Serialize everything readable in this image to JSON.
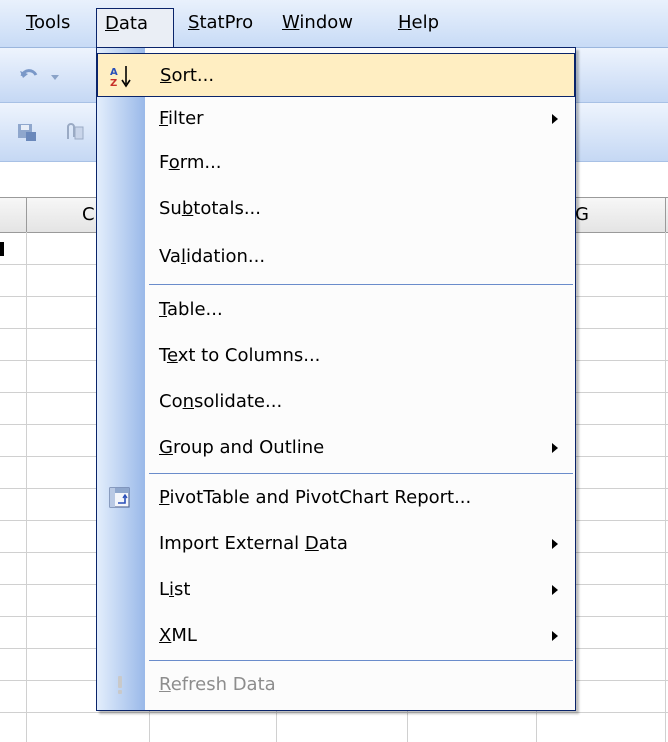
{
  "menubar": {
    "items": [
      {
        "prefix": "",
        "mnemonic": "T",
        "suffix": "ools"
      },
      {
        "prefix": "",
        "mnemonic": "D",
        "suffix": "ata"
      },
      {
        "prefix": "",
        "mnemonic": "S",
        "suffix": "tatPro"
      },
      {
        "prefix": "",
        "mnemonic": "W",
        "suffix": "indow"
      },
      {
        "prefix": "",
        "mnemonic": "H",
        "suffix": "elp"
      }
    ]
  },
  "grid": {
    "column_headers": [
      "C",
      "G"
    ]
  },
  "data_menu": {
    "items": [
      {
        "prefix": "",
        "mnemonic": "S",
        "suffix": "ort...",
        "icon": "sort-ascending-icon",
        "highlighted": true
      },
      {
        "prefix": "",
        "mnemonic": "F",
        "suffix": "ilter",
        "submenu": true
      },
      {
        "prefix": "F",
        "mnemonic": "o",
        "suffix": "rm..."
      },
      {
        "prefix": "Su",
        "mnemonic": "b",
        "suffix": "totals..."
      },
      {
        "prefix": "Va",
        "mnemonic": "l",
        "suffix": "idation..."
      },
      {
        "prefix": "",
        "mnemonic": "T",
        "suffix": "able..."
      },
      {
        "prefix": "T",
        "mnemonic": "e",
        "suffix": "xt to Columns..."
      },
      {
        "prefix": "Co",
        "mnemonic": "n",
        "suffix": "solidate..."
      },
      {
        "prefix": "",
        "mnemonic": "G",
        "suffix": "roup and Outline",
        "submenu": true
      },
      {
        "prefix": "",
        "mnemonic": "P",
        "suffix": "ivotTable and PivotChart Report...",
        "icon": "pivottable-icon"
      },
      {
        "prefix": "Import External ",
        "mnemonic": "D",
        "suffix": "ata",
        "submenu": true
      },
      {
        "prefix": "L",
        "mnemonic": "i",
        "suffix": "st",
        "submenu": true
      },
      {
        "prefix": "",
        "mnemonic": "X",
        "suffix": "ML",
        "submenu": true
      },
      {
        "prefix": "",
        "mnemonic": "R",
        "suffix": "efresh Data",
        "icon": "refresh-exclamation-icon",
        "disabled": true
      }
    ]
  },
  "colors": {
    "menu_highlight": "#ffeec2",
    "menu_border": "#0a246a",
    "separator": "#6a8ccb"
  }
}
